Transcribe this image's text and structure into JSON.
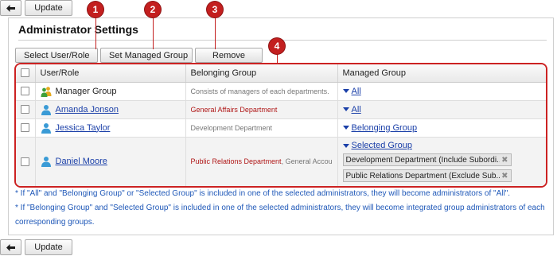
{
  "toolbar": {
    "update_label": "Update",
    "back_icon": "arrow-left-icon"
  },
  "panel": {
    "title": "Administrator Settings"
  },
  "actions": {
    "select_user_role": "Select User/Role",
    "set_managed_group": "Set Managed Group",
    "remove": "Remove"
  },
  "callouts": [
    "1",
    "2",
    "3",
    "4"
  ],
  "table": {
    "headers": {
      "user_role": "User/Role",
      "belonging_group": "Belonging Group",
      "managed_group": "Managed Group"
    },
    "rows": [
      {
        "user": "Manager Group",
        "user_icon": "role-icon",
        "belonging": "Consists of managers of each departments.",
        "managed_link": "All"
      },
      {
        "user": "Amanda Jonson",
        "user_icon": "user-icon",
        "belonging_red": "General Affairs Department",
        "managed_link": "All"
      },
      {
        "user": "Jessica Taylor",
        "user_icon": "user-icon",
        "belonging": "Development Department",
        "managed_link": "Belonging Group"
      },
      {
        "user": "Daniel Moore",
        "user_icon": "user-icon",
        "belonging_red": "Public Relations Department",
        "belonging": "General Accoun...",
        "managed_link": "Selected Group",
        "selected_groups": [
          "Development Department (Include Subordi...",
          "Public Relations Department (Exclude Sub..."
        ]
      }
    ]
  },
  "notes": [
    "* If \"All\" and \"Belonging Group\" or \"Selected Group\" is included in one of the selected administrators, they will become administrators of \"All\".",
    "* If \"Belonging Group\" and \"Selected Group\" is included in one of the selected administrators, they will become integrated group administrators of each corresponding groups."
  ],
  "colors": {
    "callout": "#c31f1f",
    "link": "#1a3fa8",
    "note": "#1f58b8",
    "department_red": "#b01818"
  }
}
